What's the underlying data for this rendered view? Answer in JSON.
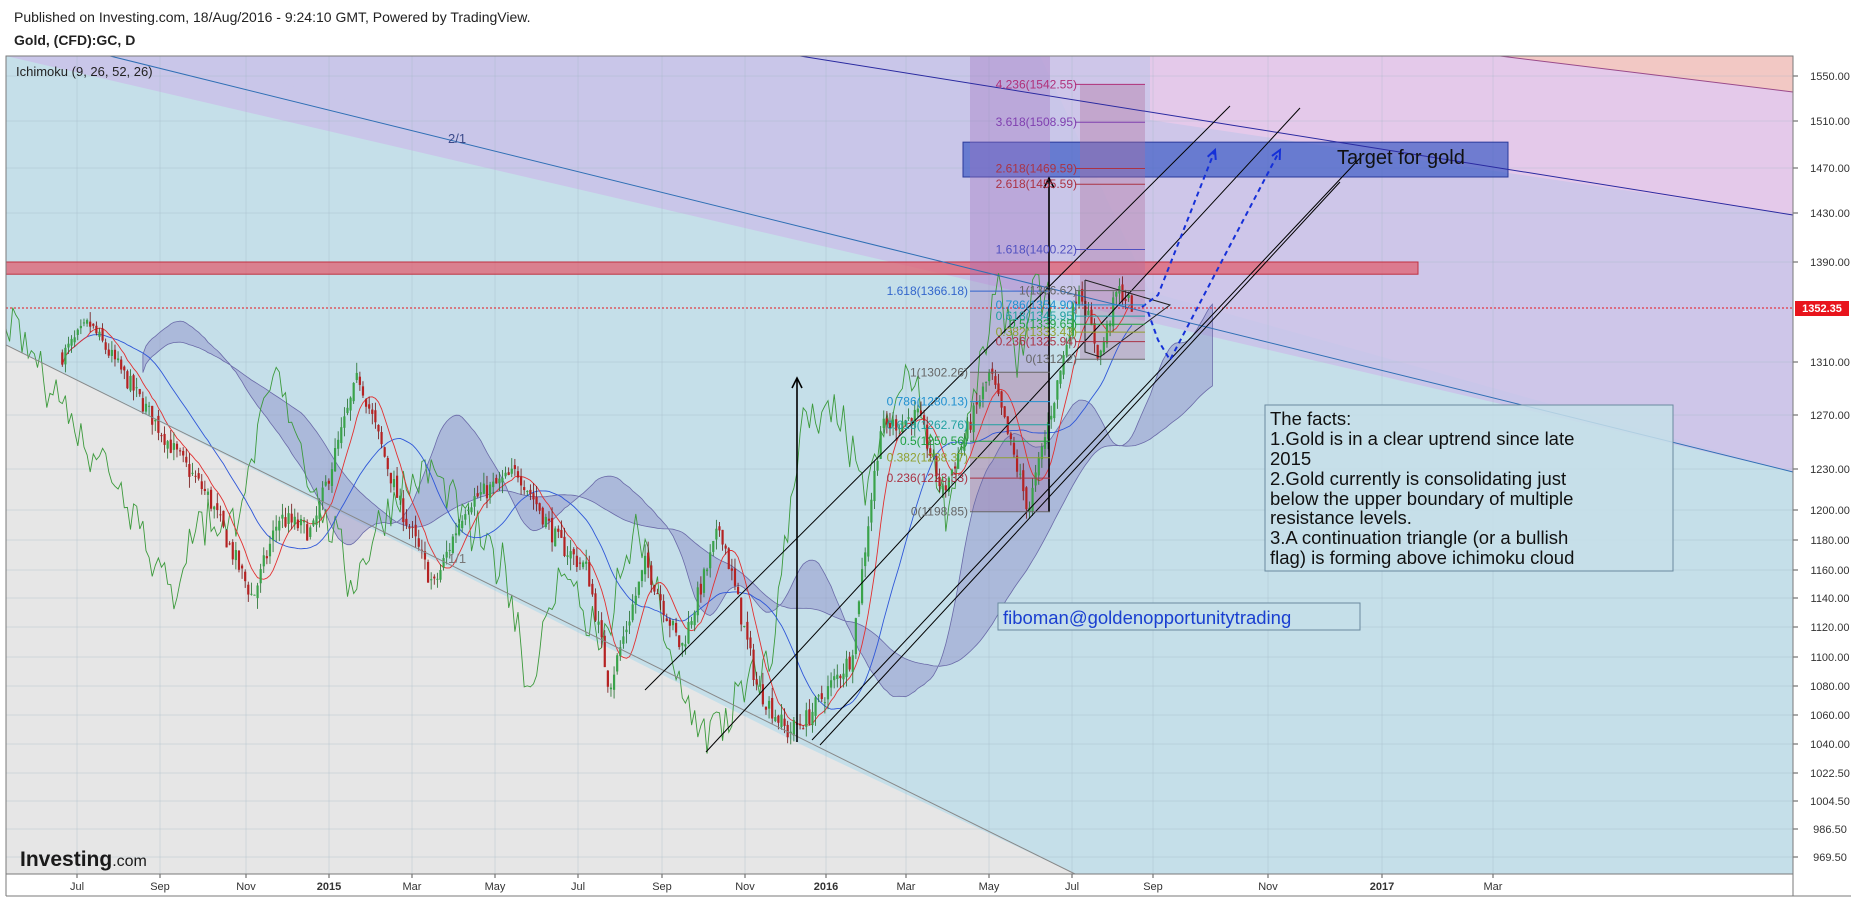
{
  "header": {
    "published": "Published on Investing.com, 18/Aug/2016 - 9:24:10 GMT, Powered by TradingView.",
    "symbol": "Gold, (CFD):GC, D"
  },
  "indicator": "Ichimoku (9, 26, 52, 26)",
  "watermark": {
    "brand": "Investing",
    "suffix": ".com"
  },
  "chart_data": {
    "type": "candlestick",
    "title": "Gold, (CFD):GC, D",
    "price_axis": {
      "ticks": [
        1550.0,
        1510.0,
        1470.0,
        1430.0,
        1390.0,
        1352.35,
        1310.0,
        1270.0,
        1230.0,
        1200.0,
        1180.0,
        1160.0,
        1140.0,
        1120.0,
        1100.0,
        1080.0,
        1060.0,
        1040.0,
        1022.5,
        1004.5,
        986.5,
        969.5
      ],
      "tick_labels": [
        "1550.00",
        "1510.00",
        "1470.00",
        "1430.00",
        "1390.00",
        "1310.00",
        "1270.00",
        "1230.00",
        "1200.00",
        "1180.00",
        "1160.00",
        "1140.00",
        "1120.00",
        "1100.00",
        "1080.00",
        "1060.00",
        "1040.00",
        "1022.50",
        "1004.50",
        "986.50",
        "969.50"
      ],
      "last_price": "1352.35",
      "last_price_color": "#e8141c"
    },
    "time_axis": {
      "labels": [
        "Jul",
        "Sep",
        "Nov",
        "2015",
        "Mar",
        "May",
        "Jul",
        "Sep",
        "Nov",
        "2016",
        "Mar",
        "May",
        "Jul",
        "Sep",
        "Nov",
        "2017",
        "Mar"
      ],
      "bold_labels": [
        "2015",
        "2016",
        "2017"
      ]
    },
    "price_path": [
      [
        "2014-06-20",
        1315
      ],
      [
        "2014-07-10",
        1340
      ],
      [
        "2014-08-05",
        1300
      ],
      [
        "2014-09-10",
        1245
      ],
      [
        "2014-10-05",
        1210
      ],
      [
        "2014-11-06",
        1140
      ],
      [
        "2014-11-25",
        1195
      ],
      [
        "2014-12-20",
        1185
      ],
      [
        "2015-01-22",
        1300
      ],
      [
        "2015-02-20",
        1205
      ],
      [
        "2015-03-17",
        1148
      ],
      [
        "2015-04-10",
        1205
      ],
      [
        "2015-05-18",
        1228
      ],
      [
        "2015-06-15",
        1180
      ],
      [
        "2015-07-08",
        1160
      ],
      [
        "2015-07-24",
        1080
      ],
      [
        "2015-08-20",
        1165
      ],
      [
        "2015-09-15",
        1105
      ],
      [
        "2015-10-14",
        1190
      ],
      [
        "2015-11-10",
        1080
      ],
      [
        "2015-12-03",
        1048
      ],
      [
        "2015-12-18",
        1058
      ],
      [
        "2016-01-20",
        1100
      ],
      [
        "2016-02-11",
        1260
      ],
      [
        "2016-03-10",
        1270
      ],
      [
        "2016-03-28",
        1212
      ],
      [
        "2016-05-02",
        1302
      ],
      [
        "2016-05-30",
        1200
      ],
      [
        "2016-06-24",
        1310
      ],
      [
        "2016-07-06",
        1372
      ],
      [
        "2016-07-22",
        1313
      ],
      [
        "2016-08-05",
        1368
      ],
      [
        "2016-08-18",
        1352
      ]
    ],
    "horizontal_lines": [
      {
        "price": 1352.35,
        "color": "#e8141c",
        "style": "dotted"
      }
    ],
    "resistance_zone": {
      "from": 1380,
      "to": 1390,
      "color": "#e06070"
    },
    "target_box": {
      "label": "Target for gold",
      "from": 1462,
      "to": 1492,
      "color": "#3d5bc4"
    },
    "fan_labels": [
      "2/1",
      "1/1"
    ],
    "fib_left": {
      "levels": [
        {
          "label": "1.618(1366.18)",
          "price": 1366.18,
          "color": "#3366cc"
        },
        {
          "label": "1(1302.26)",
          "price": 1302.26,
          "color": "#666666"
        },
        {
          "label": "0.786(1280.13)",
          "price": 1280.13,
          "color": "#2090d0"
        },
        {
          "label": "0.618(1262.76)",
          "price": 1262.76,
          "color": "#20a0a0"
        },
        {
          "label": "0.5(1250.56)",
          "price": 1250.56,
          "color": "#20a040"
        },
        {
          "label": "0.382(1238.37)",
          "price": 1238.37,
          "color": "#90a030"
        },
        {
          "label": "0.236(1223.33)",
          "price": 1223.33,
          "color": "#aa3344"
        },
        {
          "label": "0(1198.85)",
          "price": 1198.85,
          "color": "#666666"
        }
      ]
    },
    "fib_right": {
      "levels": [
        {
          "label": "4.236(1542.55)",
          "price": 1542.55,
          "color": "#b0307a"
        },
        {
          "label": "3.618(1508.95)",
          "price": 1508.95,
          "color": "#8040b0"
        },
        {
          "label": "2.618(1469.59)",
          "price": 1469.59,
          "color": "#aa3344"
        },
        {
          "label": "2.618(1455.59)",
          "price": 1455.59,
          "color": "#aa3344"
        },
        {
          "label": "1.618(1400.22)",
          "price": 1400.22,
          "color": "#5050c0"
        },
        {
          "label": "1(1366.62)",
          "price": 1366.62,
          "color": "#666666"
        },
        {
          "label": "0.786(1354.90)",
          "price": 1354.9,
          "color": "#2090d0"
        },
        {
          "label": "0.618(1345.95)",
          "price": 1345.95,
          "color": "#20a0a0"
        },
        {
          "label": "0.5(1339.65)",
          "price": 1339.65,
          "color": "#20a040"
        },
        {
          "label": "0.382(1333.43)",
          "price": 1333.43,
          "color": "#90a030"
        },
        {
          "label": "0.236(1325.94)",
          "price": 1325.94,
          "color": "#aa3344"
        },
        {
          "label": "0(1312.2)",
          "price": 1312.2,
          "color": "#666666"
        }
      ]
    },
    "notes": {
      "facts": [
        "The facts:",
        "1.Gold is in a clear uptrend since late",
        "2015",
        "2.Gold currently is consolidating just",
        "below the upper boundary of  multiple",
        "resistance levels.",
        "3.A continuation triangle (or a bullish",
        "flag) is forming above ichimoku cloud"
      ],
      "author": "fiboman@goldenopportunitytrading"
    },
    "colors": {
      "up_candle": "#3aa34a",
      "down_candle": "#b52222",
      "cloud": "#8c8cc8",
      "tenkan": "#e23030",
      "kijun": "#2f57d8",
      "chikou": "#3c9a3c",
      "channel": "#000000",
      "projection": "#1530d8",
      "bg_blue": "#c5dfe9",
      "bg_lavender": "#c9c6e9",
      "bg_pink": "#e4c9ea",
      "bg_peach": "#f2c8c4",
      "bg_grey": "#e6e6e6"
    }
  }
}
